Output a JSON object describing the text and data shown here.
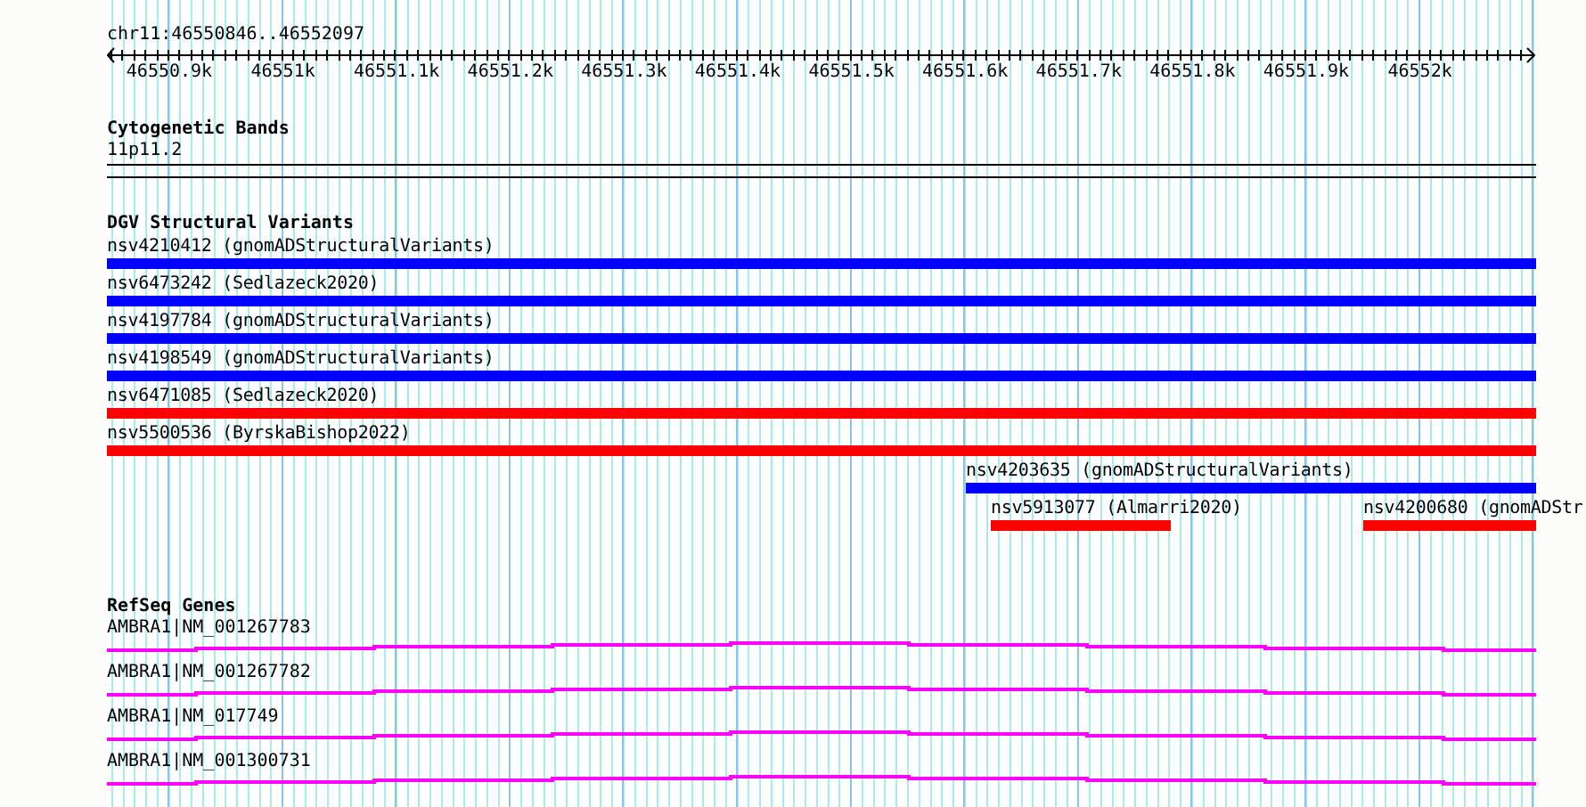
{
  "location": "chr11:46550846..46552097",
  "ruler": {
    "ticks": [
      "46550.9k",
      "46551k",
      "46551.1k",
      "46551.2k",
      "46551.3k",
      "46551.4k",
      "46551.5k",
      "46551.6k",
      "46551.7k",
      "46551.8k",
      "46551.9k",
      "46552k"
    ]
  },
  "cytogenetic_bands": {
    "title": "Cytogenetic Bands",
    "band": "11p11.2"
  },
  "dgv": {
    "title": "DGV Structural Variants",
    "variants": [
      {
        "label": "nsv4210412 (gnomADStructuralVariants)",
        "color": "#0000ff"
      },
      {
        "label": "nsv6473242 (Sedlazeck2020)",
        "color": "#0000ff"
      },
      {
        "label": "nsv4197784 (gnomADStructuralVariants)",
        "color": "#0000ff"
      },
      {
        "label": "nsv4198549 (gnomADStructuralVariants)",
        "color": "#0000ff"
      },
      {
        "label": "nsv6471085 (Sedlazeck2020)",
        "color": "#ff0000"
      },
      {
        "label": "nsv5500536 (ByrskaBishop2022)",
        "color": "#ff0000"
      },
      {
        "label": "nsv4203635 (gnomADStructuralVariants)",
        "color": "#0000ff"
      },
      {
        "label": "nsv5913077 (Almarri2020)",
        "color": "#ff0000"
      },
      {
        "label": "nsv4200680 (gnomADStr",
        "color": "#ff0000"
      }
    ]
  },
  "refseq": {
    "title": "RefSeq Genes",
    "genes": [
      {
        "name": "AMBRA1|NM_001267783"
      },
      {
        "name": "AMBRA1|NM_001267782"
      },
      {
        "name": "AMBRA1|NM_017749"
      },
      {
        "name": "AMBRA1|NM_001300731"
      }
    ]
  }
}
